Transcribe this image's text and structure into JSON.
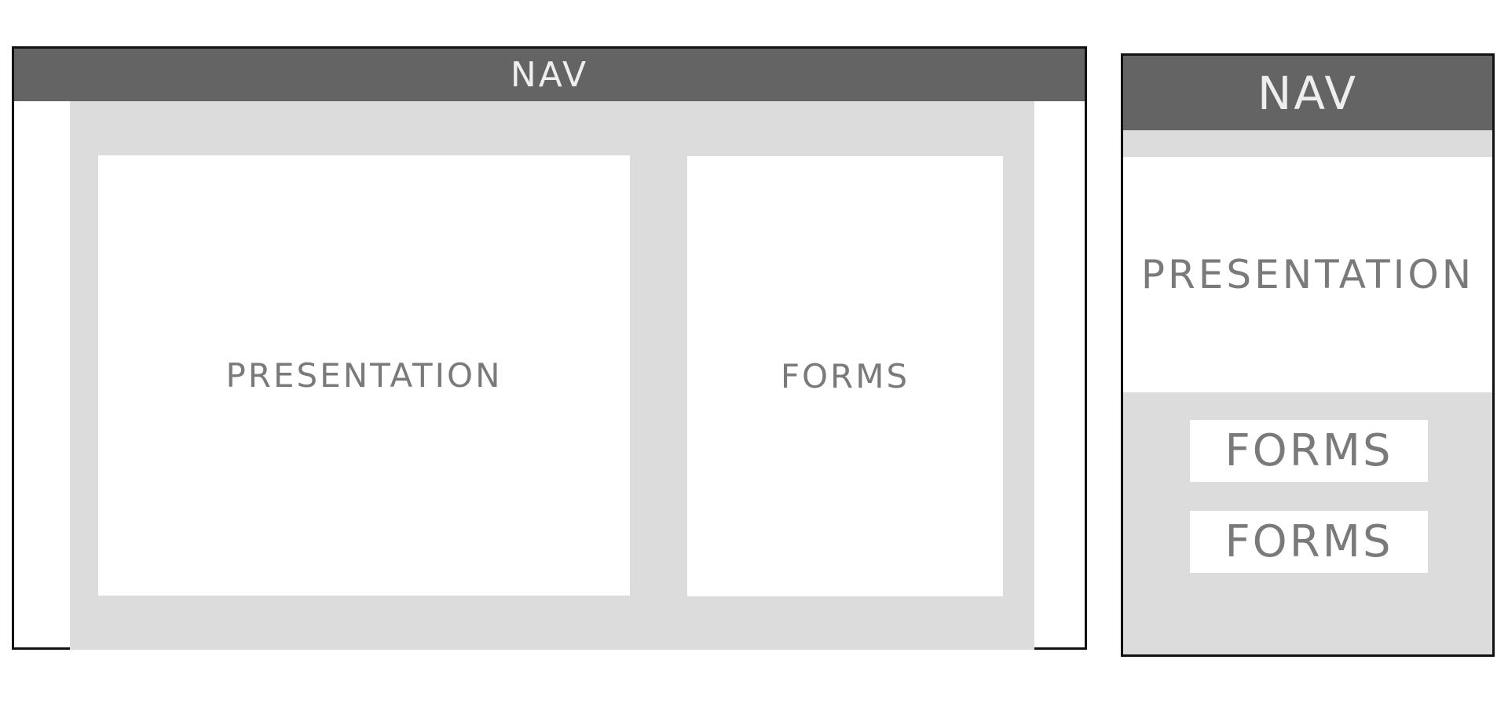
{
  "desktop": {
    "nav_label": "NAV",
    "presentation_label": "PRESENTATION",
    "forms_label": "FORMS"
  },
  "mobile": {
    "nav_label": "NAV",
    "presentation_label": "PRESENTATION",
    "forms_labels": [
      "FORMS",
      "FORMS"
    ]
  },
  "colors": {
    "nav_background": "#646464",
    "nav_text": "#eeeeee",
    "content_background": "#dcdcdd",
    "panel_background": "#ffffff",
    "panel_text": "#7a7a7a",
    "frame_border": "#111111"
  }
}
